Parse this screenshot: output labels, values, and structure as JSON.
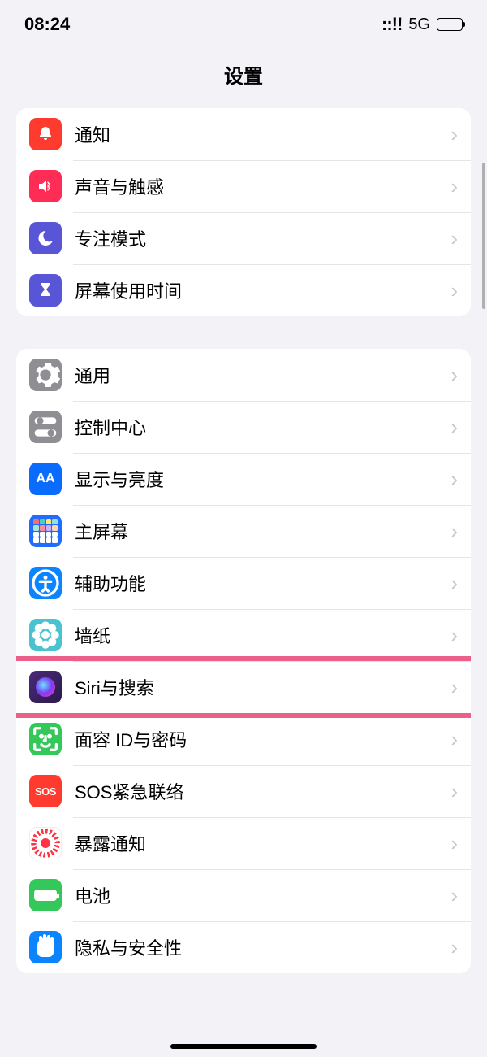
{
  "status": {
    "time": "08:24",
    "signal": "::!!",
    "network": "5G"
  },
  "nav": {
    "title": "设置"
  },
  "groups": [
    {
      "rows": [
        {
          "id": "notifications",
          "label": "通知"
        },
        {
          "id": "sounds",
          "label": "声音与触感"
        },
        {
          "id": "focus",
          "label": "专注模式"
        },
        {
          "id": "screentime",
          "label": "屏幕使用时间"
        }
      ]
    },
    {
      "rows": [
        {
          "id": "general",
          "label": "通用"
        },
        {
          "id": "control",
          "label": "控制中心"
        },
        {
          "id": "display",
          "label": "显示与亮度"
        },
        {
          "id": "home",
          "label": "主屏幕"
        },
        {
          "id": "accessibility",
          "label": "辅助功能"
        },
        {
          "id": "wallpaper",
          "label": "墙纸"
        },
        {
          "id": "siri",
          "label": "Siri与搜索",
          "highlighted": true
        },
        {
          "id": "faceid",
          "label": "面容 ID与密码"
        },
        {
          "id": "sos",
          "label": "SOS紧急联络"
        },
        {
          "id": "exposure",
          "label": "暴露通知"
        },
        {
          "id": "battery",
          "label": "电池"
        },
        {
          "id": "privacy",
          "label": "隐私与安全性"
        }
      ]
    }
  ],
  "sosText": "SOS",
  "aaText": "AA"
}
